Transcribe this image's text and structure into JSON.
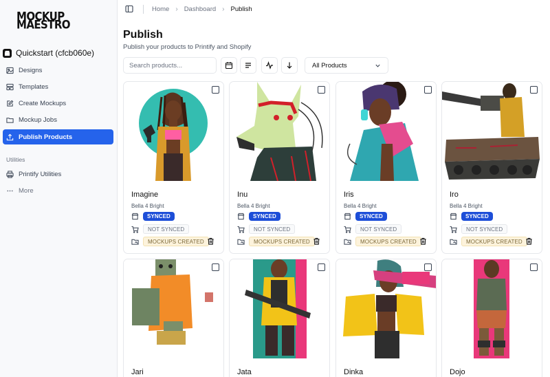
{
  "logo": {
    "line1": "MOCKUP",
    "line2": "MAESTRO"
  },
  "workspace": {
    "name": "Quickstart (cfcb060e)",
    "icon": "store-icon"
  },
  "sidebar": {
    "items": [
      {
        "label": "Designs",
        "icon": "image-icon"
      },
      {
        "label": "Templates",
        "icon": "template-icon"
      },
      {
        "label": "Create Mockups",
        "icon": "edit-icon"
      },
      {
        "label": "Mockup Jobs",
        "icon": "folder-icon"
      },
      {
        "label": "Publish Products",
        "icon": "upload-icon",
        "active": true
      }
    ],
    "section_label": "Utilities",
    "utilities": [
      {
        "label": "Printify Utilities",
        "icon": "printer-icon"
      },
      {
        "label": "More",
        "icon": "more-icon"
      }
    ]
  },
  "breadcrumb": [
    "Home",
    "Dashboard",
    "Publish"
  ],
  "page": {
    "title": "Publish",
    "subtitle": "Publish your products to Printify and Shopify"
  },
  "toolbar": {
    "search_placeholder": "Search products...",
    "filter_value": "All Products"
  },
  "products": [
    {
      "name": "Imagine",
      "variant": "Bella 4 Bright",
      "status1": "SYNCED",
      "status2": "NOT SYNCED",
      "status3": "MOCKUPS CREATED"
    },
    {
      "name": "Inu",
      "variant": "Bella 4 Bright",
      "status1": "SYNCED",
      "status2": "NOT SYNCED",
      "status3": "MOCKUPS CREATED"
    },
    {
      "name": "Iris",
      "variant": "Bella 4 Bright",
      "status1": "SYNCED",
      "status2": "NOT SYNCED",
      "status3": "MOCKUPS CREATED"
    },
    {
      "name": "Iro",
      "variant": "Bella 4 Bright",
      "status1": "SYNCED",
      "status2": "NOT SYNCED",
      "status3": "MOCKUPS CREATED"
    },
    {
      "name": "Jari"
    },
    {
      "name": "Jata"
    },
    {
      "name": "Dinka"
    },
    {
      "name": "Dojo"
    }
  ],
  "colors": {
    "accent": "#2563eb",
    "synced": "#1d4ed8",
    "mockups_bg": "#fdf3dc"
  }
}
